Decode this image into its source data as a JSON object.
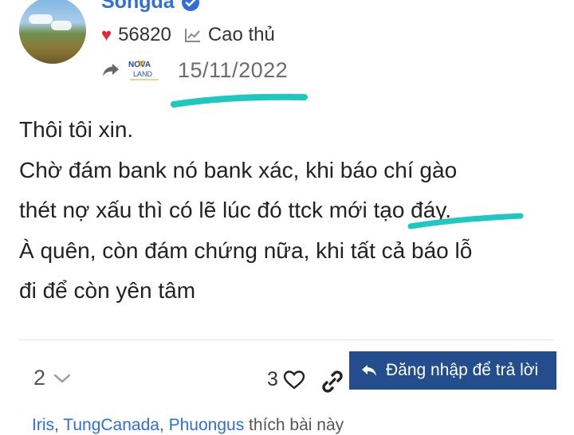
{
  "post": {
    "username": "Songda",
    "likes_count": "56820",
    "rank": "Cao thủ",
    "date": "15/11/2022",
    "logo_text_top": "NOVA",
    "logo_text_bottom": "LAND",
    "content_lines": [
      "Thôi tôi xin.",
      "Chờ đám bank nó bank xác, khi báo chí gào",
      "thét nợ xấu thì có lẽ lúc đó ttck mới tạo đáy.",
      "À quên, còn đám chứng nữa, khi tất cả báo lỗ",
      "đi để còn yên tâm"
    ]
  },
  "footer": {
    "reply_count": "2",
    "like_count": "3",
    "reply_button_label": "Đăng nhập để trả lời",
    "likers": [
      "Iris",
      "TungCanada",
      "Phuongus"
    ],
    "likers_suffix": " thích bài này"
  },
  "colors": {
    "username": "#2f6fd6",
    "button_bg": "#234d8c",
    "highlight": "#1ec8c0",
    "heart": "#e0263a"
  }
}
